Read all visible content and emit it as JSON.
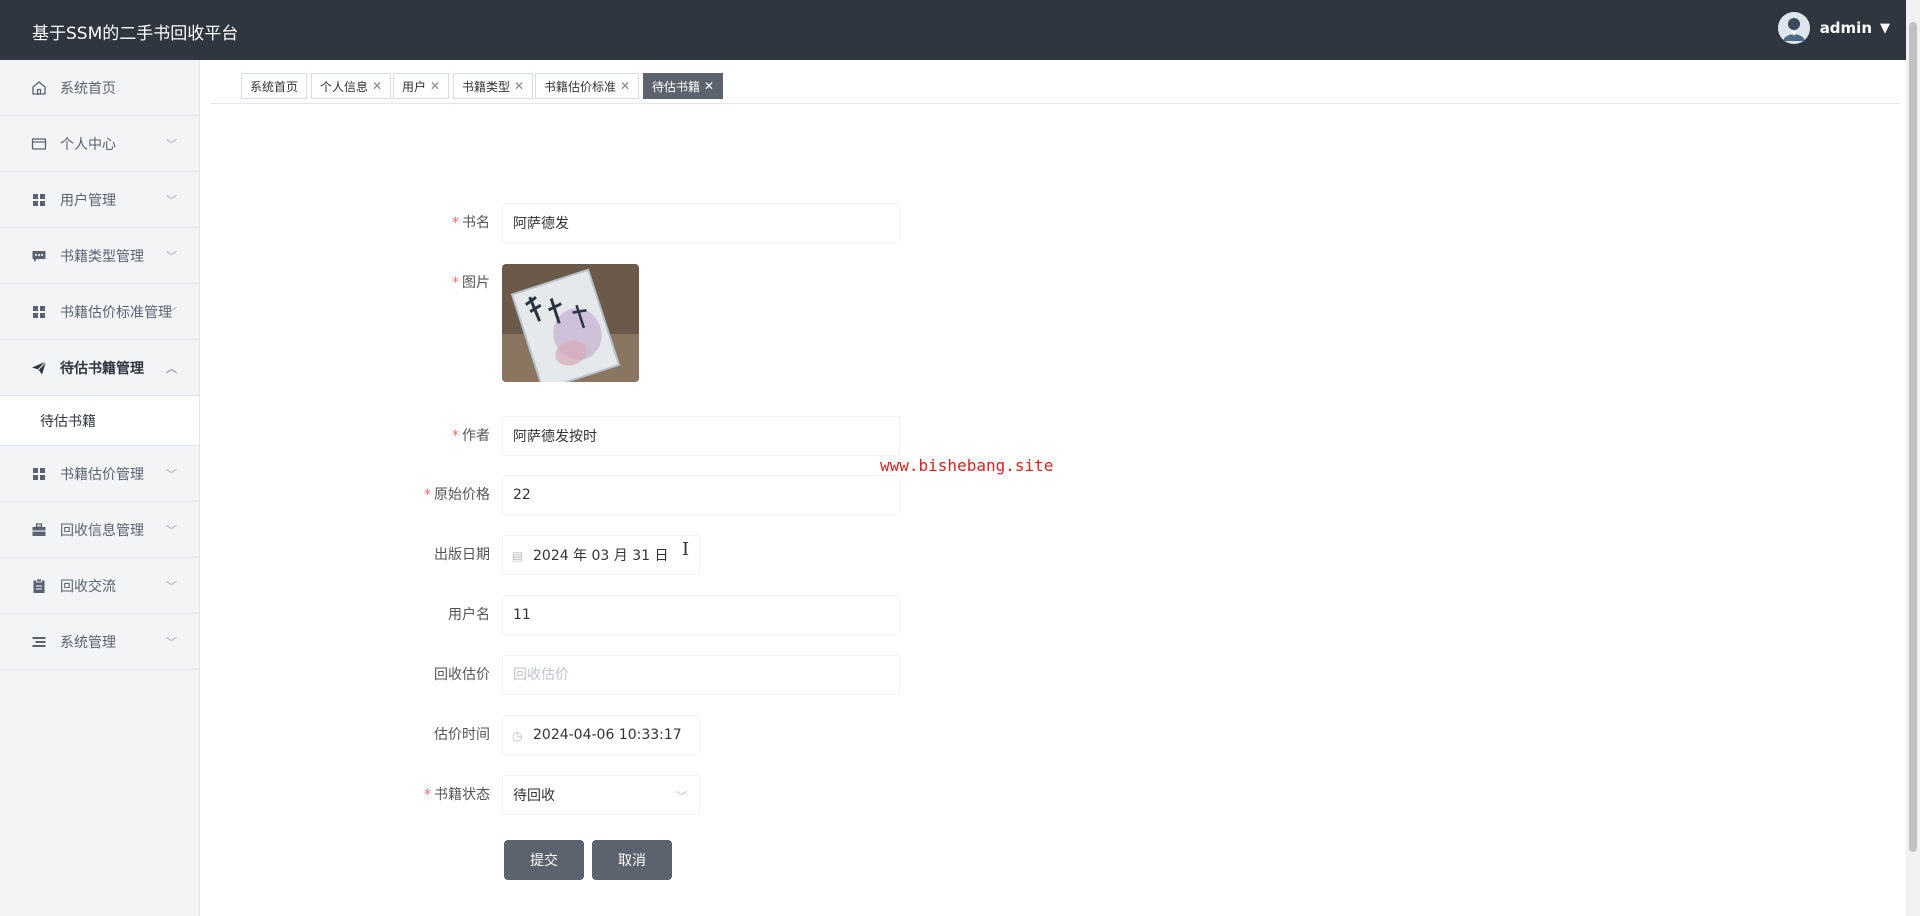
{
  "header": {
    "app_title": "基于SSM的二手书回收平台",
    "user_name": "admin"
  },
  "sidebar": {
    "items": [
      {
        "label": "系统首页",
        "icon": "home-icon"
      },
      {
        "label": "个人中心",
        "icon": "id-card-icon"
      },
      {
        "label": "用户管理",
        "icon": "grid-icon"
      },
      {
        "label": "书籍类型管理",
        "icon": "chat-icon"
      },
      {
        "label": "书籍估价标准管理",
        "icon": "grid-icon"
      },
      {
        "label": "待估书籍管理",
        "icon": "paper-plane-icon"
      },
      {
        "label": "书籍估价管理",
        "icon": "grid-icon"
      },
      {
        "label": "回收信息管理",
        "icon": "briefcase-icon"
      },
      {
        "label": "回收交流",
        "icon": "clipboard-icon"
      },
      {
        "label": "系统管理",
        "icon": "list-icon"
      }
    ],
    "subitem": "待估书籍"
  },
  "tabs": [
    {
      "label": "系统首页"
    },
    {
      "label": "个人信息"
    },
    {
      "label": "用户"
    },
    {
      "label": "书籍类型"
    },
    {
      "label": "书籍估价标准"
    },
    {
      "label": "待估书籍"
    }
  ],
  "form": {
    "book_name": {
      "label": "书名",
      "value": "阿萨德发"
    },
    "image": {
      "label": "图片"
    },
    "author": {
      "label": "作者",
      "value": "阿萨德发按时"
    },
    "original_price": {
      "label": "原始价格",
      "value": "22"
    },
    "publish_date": {
      "label": "出版日期",
      "value": "2024 年 03 月 31 日"
    },
    "username": {
      "label": "用户名",
      "value": "11"
    },
    "recycle_estimate": {
      "label": "回收估价",
      "placeholder": "回收估价"
    },
    "estimate_time": {
      "label": "估价时间",
      "value": "2024-04-06 10:33:17"
    },
    "book_status": {
      "label": "书籍状态",
      "value": "待回收"
    }
  },
  "buttons": {
    "submit": "提交",
    "cancel": "取消"
  },
  "watermark": "www.bishebang.site",
  "colors": {
    "header_bg": "#2f3640",
    "button_bg": "#5c636e",
    "required": "#f56c6c",
    "watermark": "#d9231f"
  }
}
